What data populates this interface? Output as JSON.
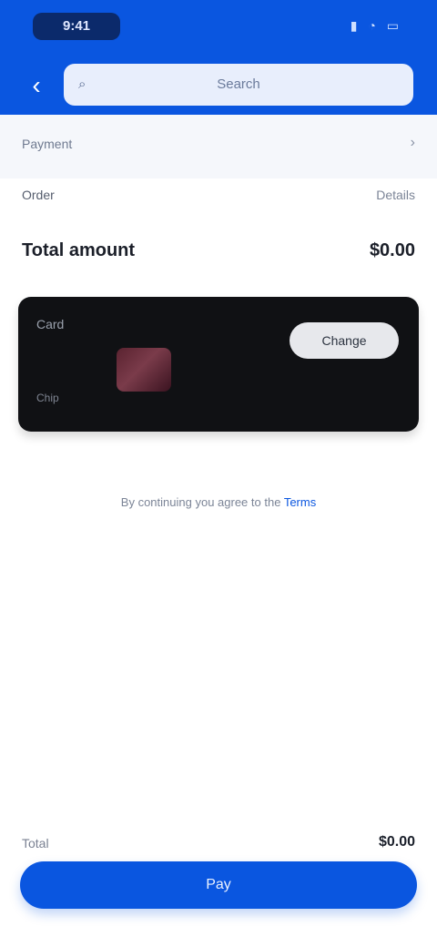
{
  "status": {
    "time": "9:41",
    "icons": [
      "signal-icon",
      "wifi-icon",
      "battery-icon"
    ]
  },
  "header": {
    "back_label": "‹",
    "search_placeholder": "Search",
    "accent": "#0a56e0"
  },
  "subheader": {
    "left": "Payment",
    "right": "›"
  },
  "summary": {
    "row1_left": "Order",
    "row1_right": "Details",
    "row2_left": "Total amount",
    "row2_right": "$0.00"
  },
  "card": {
    "brand": "Card",
    "chip_label": "Chip",
    "pill_label": "Change",
    "note": ""
  },
  "terms": {
    "text": "By continuing you agree to the",
    "link": "Terms"
  },
  "footer": {
    "total_label": "Total",
    "total_value": "$0.00",
    "button_label": "Pay"
  }
}
